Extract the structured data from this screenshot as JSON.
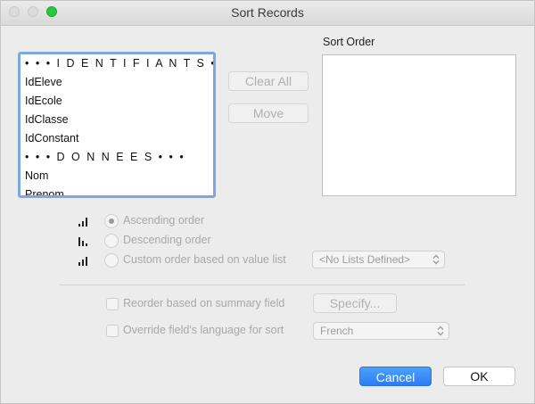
{
  "window": {
    "title": "Sort Records"
  },
  "field_list": {
    "items": [
      "• • • I D E N T I F I A N T S • • •",
      "IdEleve",
      "IdEcole",
      "IdClasse",
      "IdConstant",
      "• • • D O N N E E S • • •",
      "Nom",
      "Prenom"
    ]
  },
  "buttons": {
    "clear_all": "Clear All",
    "move": "Move",
    "specify": "Specify...",
    "cancel": "Cancel",
    "ok": "OK"
  },
  "sort_order": {
    "label": "Sort Order"
  },
  "order_options": {
    "ascending": "Ascending order",
    "descending": "Descending order",
    "custom": "Custom order based on value list",
    "selected": "ascending"
  },
  "value_list_popup": {
    "value": "<No Lists Defined>"
  },
  "options": {
    "reorder_summary": "Reorder based on summary field",
    "override_language": "Override field's language for sort",
    "reorder_checked": false,
    "override_checked": false
  },
  "language_popup": {
    "value": "French"
  },
  "icons": {
    "close": "close-icon",
    "minimize": "minimize-icon",
    "zoom": "zoom-icon",
    "ascending": "ascending-order-icon",
    "descending": "descending-order-icon",
    "custom": "custom-order-icon",
    "popup": "popup-arrows-icon"
  },
  "colors": {
    "accent": "#2d7cf6",
    "focus_ring": "#7ea6e0",
    "zoom_button": "#28c840"
  }
}
